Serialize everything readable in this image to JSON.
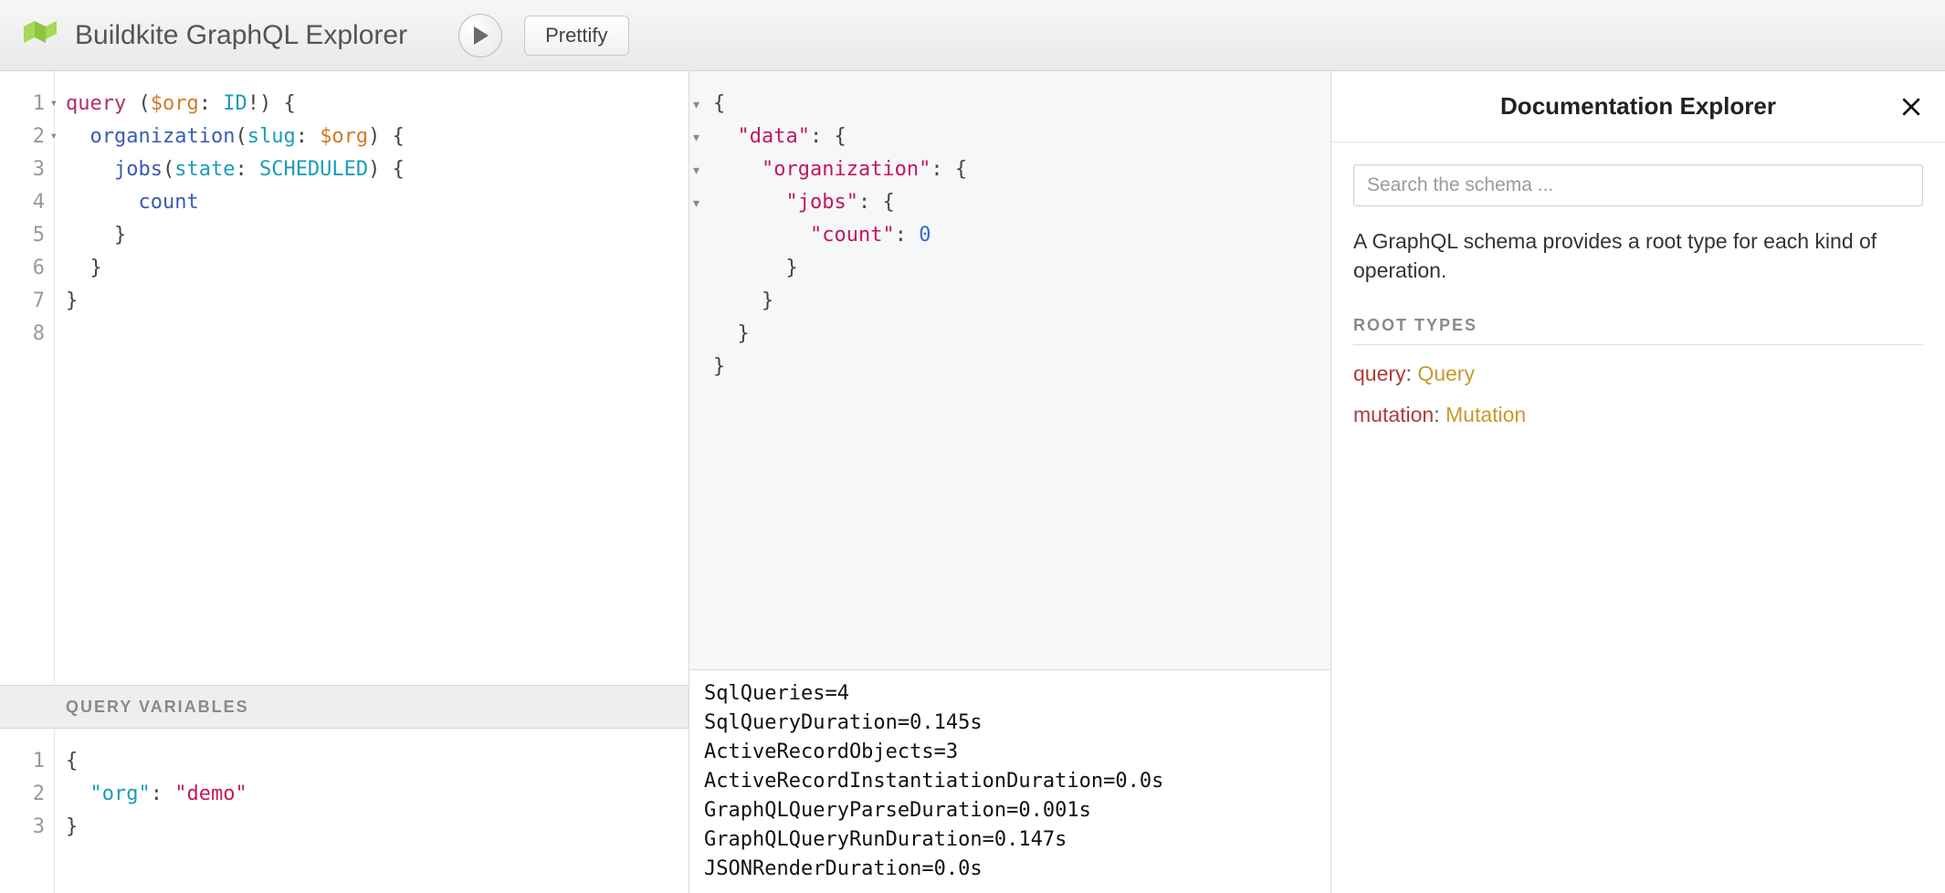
{
  "app_title": "Buildkite GraphQL Explorer",
  "toolbar": {
    "prettify_label": "Prettify"
  },
  "query_editor": {
    "lines": [
      {
        "n": 1,
        "foldable": true
      },
      {
        "n": 2,
        "foldable": true
      },
      {
        "n": 3,
        "foldable": false
      },
      {
        "n": 4,
        "foldable": false
      },
      {
        "n": 5,
        "foldable": false
      },
      {
        "n": 6,
        "foldable": false
      },
      {
        "n": 7,
        "foldable": false
      },
      {
        "n": 8,
        "foldable": false
      }
    ],
    "tokens": {
      "l1_keyword": "query",
      "l1_var": "$org",
      "l1_type": "ID",
      "l1_bang": "!",
      "l2_field": "organization",
      "l2_arg": "slug",
      "l2_var": "$org",
      "l3_field": "jobs",
      "l3_arg": "state",
      "l3_enum": "SCHEDULED",
      "l4_field": "count"
    }
  },
  "variables_header": "Query Variables",
  "variables_editor": {
    "lines": [
      1,
      2,
      3
    ],
    "key": "\"org\"",
    "value": "\"demo\""
  },
  "result": {
    "tokens": {
      "data": "\"data\"",
      "organization": "\"organization\"",
      "jobs": "\"jobs\"",
      "count": "\"count\"",
      "count_value": "0"
    }
  },
  "footer_stats": [
    "SqlQueries=4",
    "SqlQueryDuration=0.145s",
    "ActiveRecordObjects=3",
    "ActiveRecordInstantiationDuration=0.0s",
    "GraphQLQueryParseDuration=0.001s",
    "GraphQLQueryRunDuration=0.147s",
    "JSONRenderDuration=0.0s"
  ],
  "docs": {
    "title": "Documentation Explorer",
    "search_placeholder": "Search the schema ...",
    "description": "A GraphQL schema provides a root type for each kind of operation.",
    "section_title": "Root Types",
    "fields": [
      {
        "name": "query",
        "type": "Query"
      },
      {
        "name": "mutation",
        "type": "Mutation"
      }
    ]
  }
}
